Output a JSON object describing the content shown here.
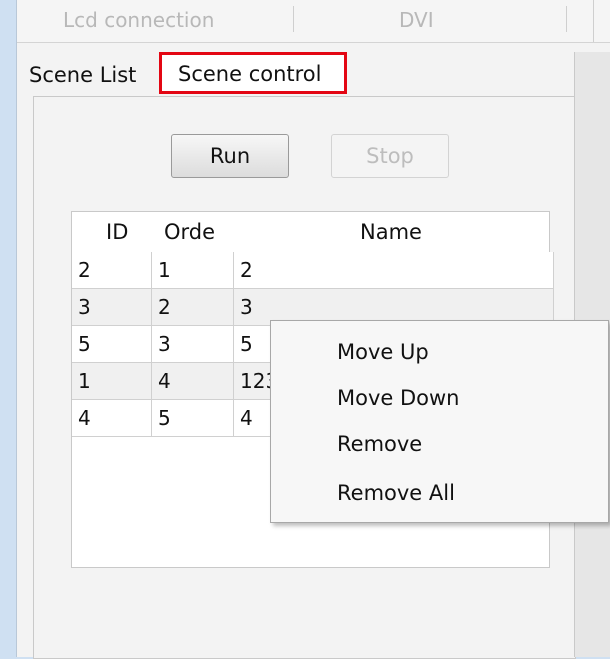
{
  "top_tabs": [
    "Lcd connection",
    "DVI"
  ],
  "tabs": {
    "scene_list": "Scene List",
    "scene_control": "Scene control"
  },
  "buttons": {
    "run": "Run",
    "stop": "Stop"
  },
  "table": {
    "headers": [
      "ID",
      "Orde",
      "Name"
    ],
    "rows": [
      {
        "id": "2",
        "order": "1",
        "name": "2"
      },
      {
        "id": "3",
        "order": "2",
        "name": "3"
      },
      {
        "id": "5",
        "order": "3",
        "name": "5"
      },
      {
        "id": "1",
        "order": "4",
        "name": "123"
      },
      {
        "id": "4",
        "order": "5",
        "name": "4"
      }
    ]
  },
  "context_menu": [
    "Move Up",
    "Move Down",
    "Remove",
    "Remove All"
  ],
  "colors": {
    "highlight": "#e30613"
  }
}
